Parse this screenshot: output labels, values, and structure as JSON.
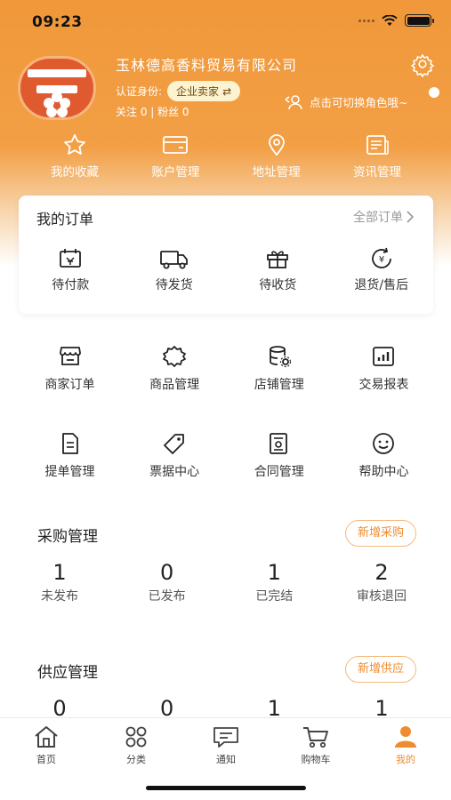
{
  "status_bar": {
    "time": "09:23"
  },
  "profile": {
    "company_name": "玉林德高香料贸易有限公司",
    "identity_label": "认证身份:",
    "identity_badge": "企业卖家",
    "swap_glyph": "⇄",
    "follow_text": "关注 0 | 粉丝 0",
    "switch_role_text": "点击可切换角色哦~",
    "icons": {
      "settings": "gear-icon",
      "switch": "user-switch-icon"
    }
  },
  "quick_links": [
    {
      "label": "我的收藏",
      "icon": "star-icon"
    },
    {
      "label": "账户管理",
      "icon": "card-icon"
    },
    {
      "label": "地址管理",
      "icon": "location-pin-icon"
    },
    {
      "label": "资讯管理",
      "icon": "news-icon"
    }
  ],
  "orders": {
    "title": "我的订单",
    "all_label": "全部订单",
    "items": [
      {
        "label": "待付款",
        "icon": "wallet-icon"
      },
      {
        "label": "待发货",
        "icon": "truck-icon"
      },
      {
        "label": "待收货",
        "icon": "gift-icon"
      },
      {
        "label": "退货/售后",
        "icon": "refund-icon"
      }
    ]
  },
  "tools_row1": [
    {
      "label": "商家订单",
      "icon": "store-icon"
    },
    {
      "label": "商品管理",
      "icon": "badge-icon"
    },
    {
      "label": "店铺管理",
      "icon": "database-gear-icon"
    },
    {
      "label": "交易报表",
      "icon": "bar-chart-icon"
    }
  ],
  "tools_row2": [
    {
      "label": "提单管理",
      "icon": "document-icon"
    },
    {
      "label": "票据中心",
      "icon": "tag-icon"
    },
    {
      "label": "合同管理",
      "icon": "contract-icon"
    },
    {
      "label": "帮助中心",
      "icon": "smile-icon"
    }
  ],
  "purchase": {
    "title": "采购管理",
    "button": "新增采购",
    "stats": [
      {
        "value": "1",
        "label": "未发布"
      },
      {
        "value": "0",
        "label": "已发布"
      },
      {
        "value": "1",
        "label": "已完结"
      },
      {
        "value": "2",
        "label": "审核退回"
      }
    ]
  },
  "supply": {
    "title": "供应管理",
    "button": "新增供应",
    "stats": [
      {
        "value": "0"
      },
      {
        "value": "0"
      },
      {
        "value": "1"
      },
      {
        "value": "1"
      }
    ]
  },
  "tab_bar": [
    {
      "label": "首页",
      "icon": "home-icon"
    },
    {
      "label": "分类",
      "icon": "grid-icon"
    },
    {
      "label": "通知",
      "icon": "message-icon"
    },
    {
      "label": "购物车",
      "icon": "cart-icon"
    },
    {
      "label": "我的",
      "icon": "person-icon",
      "active": true
    }
  ],
  "colors": {
    "accent": "#ef8c2f",
    "header": "#f0983a",
    "badge_bg": "#fdf3d0"
  }
}
